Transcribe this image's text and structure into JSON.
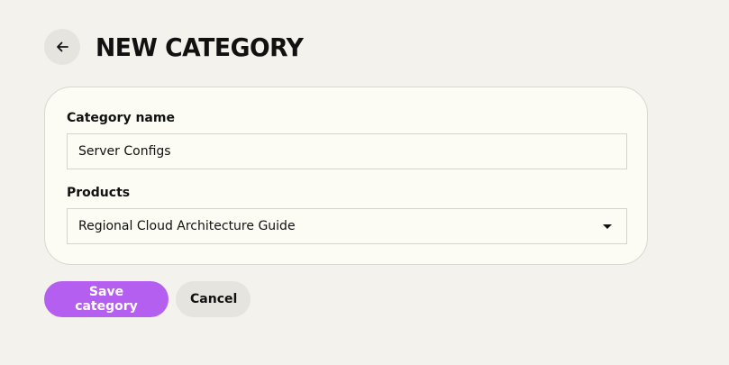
{
  "header": {
    "back_icon": "arrow-left-icon",
    "title": "NEW CATEGORY"
  },
  "form": {
    "category_name": {
      "label": "Category name",
      "value": "Server Configs"
    },
    "products": {
      "label": "Products",
      "selected": "Regional Cloud Architecture Guide",
      "dropdown_icon": "caret-down-icon"
    }
  },
  "actions": {
    "save_label": "Save category",
    "cancel_label": "Cancel"
  },
  "colors": {
    "background": "#f3f2ec",
    "card": "#fcfcf4",
    "primary": "#b45ff0",
    "secondary": "#e5e4de"
  }
}
